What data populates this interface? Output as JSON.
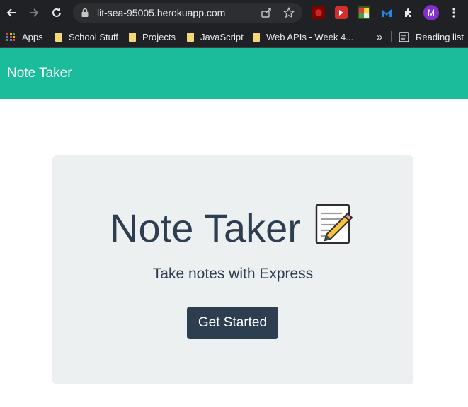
{
  "browser": {
    "url": "lit-sea-95005.herokuapp.com",
    "profile_initial": "M",
    "bookmarks": [
      {
        "label": "Apps"
      },
      {
        "label": "School Stuff"
      },
      {
        "label": "Projects"
      },
      {
        "label": "JavaScript"
      },
      {
        "label": "Web APIs - Week 4..."
      }
    ],
    "overflow_label": "»",
    "reading_list": "Reading list"
  },
  "navbar": {
    "brand": "Note Taker",
    "color": "#1abc9c"
  },
  "hero": {
    "title": "Note Taker",
    "subtitle": "Take notes with Express",
    "button_label": "Get Started",
    "button_color": "#2c3e50",
    "background": "#ecf0f1"
  }
}
